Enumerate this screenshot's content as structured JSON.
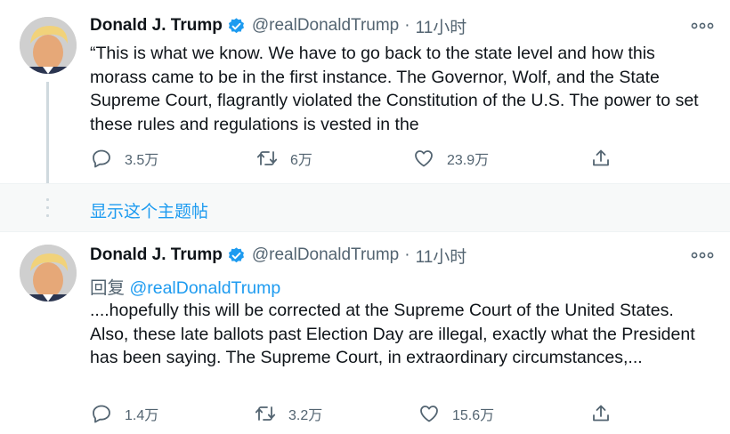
{
  "tweets": [
    {
      "name": "Donald J. Trump",
      "handle": "@realDonaldTrump",
      "separator": "·",
      "time": "11小时",
      "text": "“This is what we know. We have to go back to the state level and how this morass came to be in the first instance. The Governor, Wolf, and the State Supreme Court, flagrantly violated the Constitution of the U.S. The power to set these rules and regulations is vested in the",
      "reply_count": "3.5万",
      "retweet_count": "6万",
      "like_count": "23.9万"
    },
    {
      "name": "Donald J. Trump",
      "handle": "@realDonaldTrump",
      "separator": "·",
      "time": "11小时",
      "reply_prefix": "回复",
      "reply_mention": "@realDonaldTrump",
      "text": "....hopefully this will be corrected at the Supreme Court of the United States. Also, these late ballots past Election Day are illegal, exactly what the President has been saying. The Supreme Court, in extraordinary circumstances,...",
      "reply_count": "1.4万",
      "retweet_count": "3.2万",
      "like_count": "15.6万"
    }
  ],
  "show_thread_label": "显示这个主题帖",
  "icons": [
    "avatar",
    "verified-badge-icon",
    "more-icon",
    "reply-icon",
    "retweet-icon",
    "like-icon",
    "share-icon"
  ],
  "colors": {
    "accent": "#1d9bf0",
    "text_primary": "#0f1419",
    "text_secondary": "#536471",
    "thread_bg": "#f7f9f9"
  }
}
